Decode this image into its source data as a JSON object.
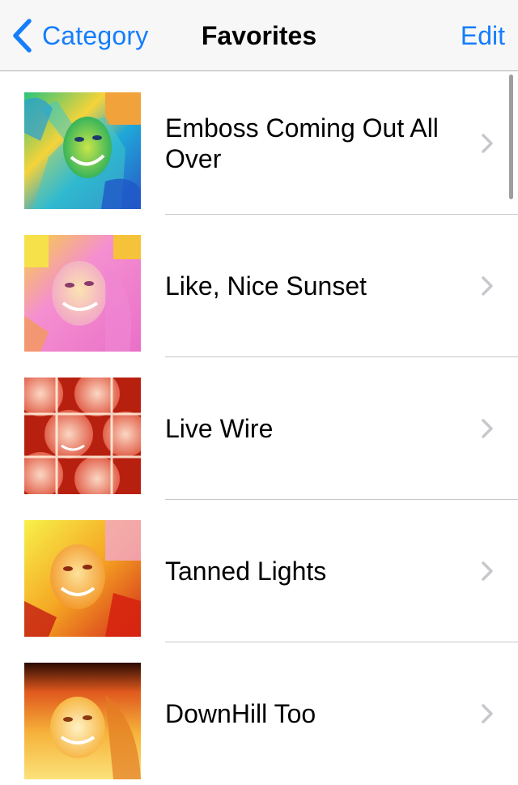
{
  "navbar": {
    "back_label": "Category",
    "title": "Favorites",
    "edit_label": "Edit"
  },
  "items": [
    {
      "label": "Emboss Coming Out All Over",
      "thumbnail": "emboss-effect-photo"
    },
    {
      "label": "Like, Nice Sunset",
      "thumbnail": "sunset-effect-photo"
    },
    {
      "label": "Live Wire",
      "thumbnail": "live-wire-effect-photo"
    },
    {
      "label": "Tanned Lights",
      "thumbnail": "tanned-lights-effect-photo"
    },
    {
      "label": "DownHill Too",
      "thumbnail": "downhill-effect-photo"
    }
  ],
  "colors": {
    "accent": "#157efb",
    "separator": "#c8c7cc",
    "chevron": "#c7c7cc"
  }
}
